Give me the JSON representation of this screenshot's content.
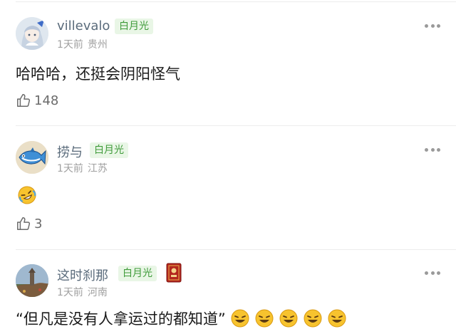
{
  "comments": [
    {
      "username": "villevalo",
      "badge": "白月光",
      "time": "1天前",
      "location": "贵州",
      "text": "哈哈哈，还挺会阴阳怪气",
      "likes": "148",
      "avatar_icon": "anime-girl-avatar"
    },
    {
      "username": "捞与",
      "badge": "白月光",
      "time": "1天前",
      "location": "江苏",
      "text": "",
      "emoji": "rofl-emoji",
      "likes": "3",
      "avatar_icon": "fish-avatar"
    },
    {
      "username": "这时刹那",
      "badge": "白月光",
      "time": "1天前",
      "location": "河南",
      "text": "“但凡是没有人拿运过的都知道”",
      "emoji_count_shown": 5,
      "avatar_icon": "tower-landscape-avatar",
      "extra_badge_icon": "red-book-medal-icon"
    }
  ],
  "colors": {
    "badge_text": "#3f9b3a",
    "badge_bg": "#e9f6e6",
    "username": "#5a6b7b",
    "meta": "#a0a0a0"
  }
}
